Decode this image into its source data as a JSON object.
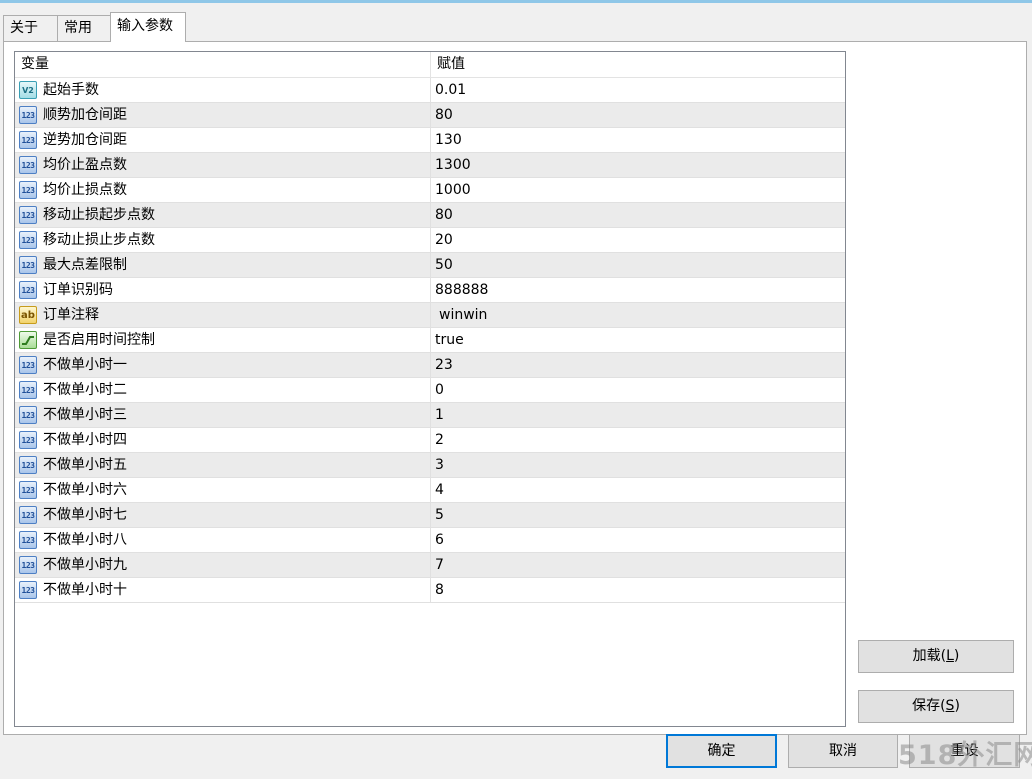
{
  "tabs": [
    {
      "label": "关于",
      "active": false
    },
    {
      "label": "常用",
      "active": false
    },
    {
      "label": "输入参数",
      "active": true
    }
  ],
  "table": {
    "columns": [
      "变量",
      "赋值"
    ],
    "rows": [
      {
        "type": "double",
        "icon": "v2-icon",
        "name": "起始手数",
        "value": "0.01"
      },
      {
        "type": "int",
        "icon": "123-icon",
        "name": "顺势加仓间距",
        "value": "80"
      },
      {
        "type": "int",
        "icon": "123-icon",
        "name": "逆势加仓间距",
        "value": "130"
      },
      {
        "type": "int",
        "icon": "123-icon",
        "name": "均价止盈点数",
        "value": "1300"
      },
      {
        "type": "int",
        "icon": "123-icon",
        "name": "均价止损点数",
        "value": "1000"
      },
      {
        "type": "int",
        "icon": "123-icon",
        "name": "移动止损起步点数",
        "value": "80"
      },
      {
        "type": "int",
        "icon": "123-icon",
        "name": "移动止损止步点数",
        "value": "20"
      },
      {
        "type": "int",
        "icon": "123-icon",
        "name": "最大点差限制",
        "value": "50"
      },
      {
        "type": "int",
        "icon": "123-icon",
        "name": "订单识别码",
        "value": "888888"
      },
      {
        "type": "string",
        "icon": "ab-icon",
        "name": "订单注释",
        "value": "winwin"
      },
      {
        "type": "bool",
        "icon": "bool-icon",
        "name": "是否启用时间控制",
        "value": "true"
      },
      {
        "type": "int",
        "icon": "123-icon",
        "name": "不做单小时一",
        "value": "23"
      },
      {
        "type": "int",
        "icon": "123-icon",
        "name": "不做单小时二",
        "value": "0"
      },
      {
        "type": "int",
        "icon": "123-icon",
        "name": "不做单小时三",
        "value": "1"
      },
      {
        "type": "int",
        "icon": "123-icon",
        "name": "不做单小时四",
        "value": "2"
      },
      {
        "type": "int",
        "icon": "123-icon",
        "name": "不做单小时五",
        "value": "3"
      },
      {
        "type": "int",
        "icon": "123-icon",
        "name": "不做单小时六",
        "value": "4"
      },
      {
        "type": "int",
        "icon": "123-icon",
        "name": "不做单小时七",
        "value": "5"
      },
      {
        "type": "int",
        "icon": "123-icon",
        "name": "不做单小时八",
        "value": "6"
      },
      {
        "type": "int",
        "icon": "123-icon",
        "name": "不做单小时九",
        "value": "7"
      },
      {
        "type": "int",
        "icon": "123-icon",
        "name": "不做单小时十",
        "value": "8"
      }
    ]
  },
  "side_buttons": {
    "load_label": "加载",
    "load_key": "L",
    "save_label": "保存",
    "save_key": "S"
  },
  "bottom_buttons": {
    "ok_label": "确定",
    "cancel_label": "取消",
    "reset_label": "重设"
  },
  "watermark": "518外汇网",
  "colors": {
    "background": "#f0f0f0",
    "alt_row": "#ebebeb",
    "default_button_border": "#0078d7",
    "tab_top_border": "#8fc7e8"
  }
}
